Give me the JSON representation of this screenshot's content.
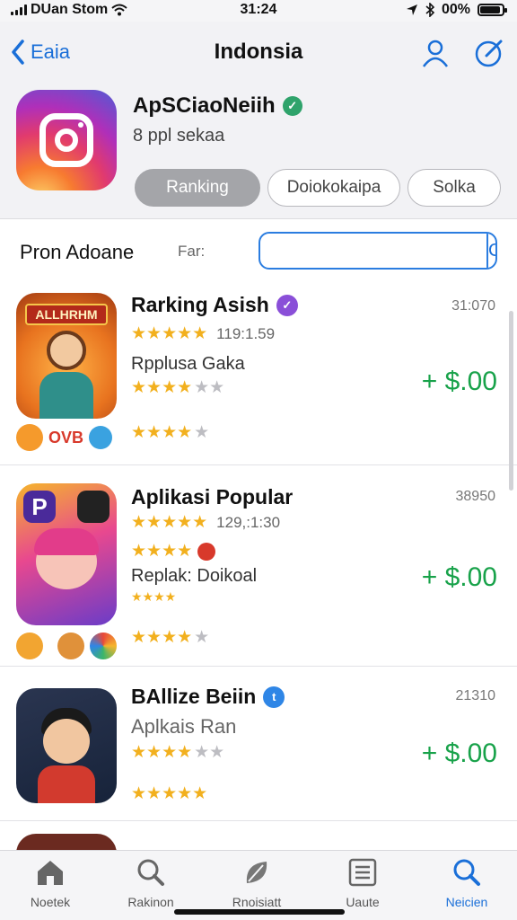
{
  "status_bar": {
    "carrier": "DUan Stom",
    "time": "31:24",
    "battery": "00%"
  },
  "nav": {
    "back_label": "Eaia",
    "title": "Indonsia"
  },
  "app": {
    "name": "ApSCiaoNeiih",
    "subtitle": "8 ppl sekaa",
    "tabs": [
      {
        "label": "Ranking",
        "active": true
      },
      {
        "label": "Doiokokaipa",
        "active": false
      },
      {
        "label": "Solka",
        "active": false
      }
    ]
  },
  "filter": {
    "title": "Pron Adoane",
    "label": "Far:",
    "input_value": "",
    "button_label": "Caпаmvlп"
  },
  "list": [
    {
      "title": "Rarking Asish",
      "badge_color": "#8a4fd8",
      "badge_glyph": "✓",
      "count": "31:070",
      "rating_meta": "119:1.59",
      "subtitle": "Rpplusa Gaka",
      "price": "+ $.00",
      "thumb_label": "ALLHRHM",
      "chip_text": "OVB"
    },
    {
      "title": "Aplikasi Popular",
      "badge_color": "",
      "badge_glyph": "",
      "count": "38950",
      "rating_meta": "129,:1:30",
      "subtitle": "Replak: Doikoal",
      "price": "+ $.00",
      "thumb_label": "P",
      "chip_text": ""
    },
    {
      "title": "BAllize Beiin",
      "badge_color": "#2f86e6",
      "badge_glyph": "t",
      "count": "21310",
      "rating_meta": "",
      "subtitle": "Aplkais Ran",
      "price": "+ $.00",
      "thumb_label": "",
      "chip_text": ""
    }
  ],
  "tabbar": [
    {
      "label": "Noetek",
      "icon": "home-icon",
      "active": false
    },
    {
      "label": "Rakinon",
      "icon": "search-icon",
      "active": false
    },
    {
      "label": "Rnoisiatt",
      "icon": "leaf-icon",
      "active": false
    },
    {
      "label": "Uaute",
      "icon": "grid-icon",
      "active": false
    },
    {
      "label": "Neicien",
      "icon": "search-icon",
      "active": true
    }
  ],
  "colors": {
    "accent": "#1a6fd8",
    "price": "#18a24a",
    "star": "#f2b01e"
  }
}
